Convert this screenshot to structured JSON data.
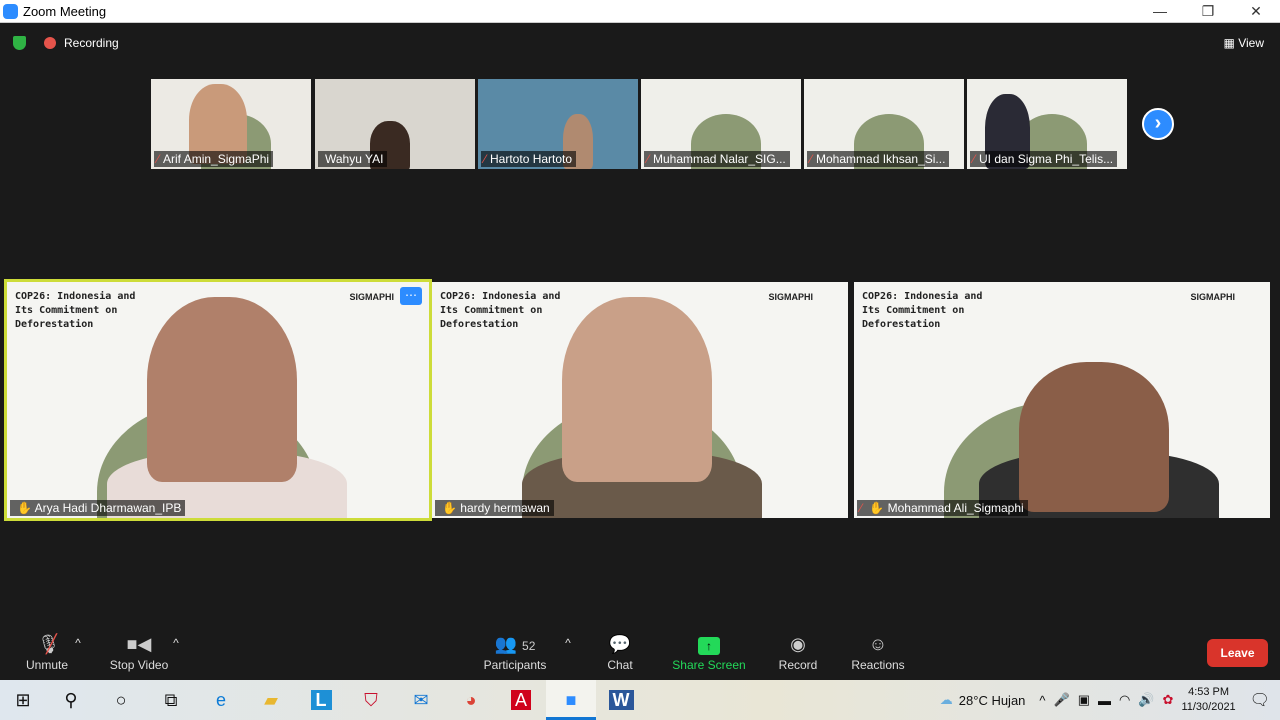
{
  "window": {
    "title": "Zoom Meeting",
    "minimize": "—",
    "maximize": "❐",
    "close": "✕"
  },
  "topbar": {
    "recording": "Recording",
    "view": "View"
  },
  "thumbnails": [
    {
      "name": "Arif Amin_SigmaPhi",
      "muted": true
    },
    {
      "name": "Wahyu YAI",
      "muted": false
    },
    {
      "name": "Hartoto Hartoto",
      "muted": true
    },
    {
      "name": "Muhammad Nalar_SIG...",
      "muted": true
    },
    {
      "name": "Mohammad Ikhsan_Si...",
      "muted": true
    },
    {
      "name": "UI dan Sigma Phi_Telis...",
      "muted": true
    }
  ],
  "slide": {
    "title": "COP26: Indonesia and Its Commitment on Deforestation",
    "brand": "SIGMAPHI"
  },
  "tiles": [
    {
      "name": "Arya Hadi Dharmawan_IPB",
      "active": true,
      "muted": false
    },
    {
      "name": "hardy hermawan",
      "active": false,
      "muted": false
    },
    {
      "name": "Mohammad Ali_Sigmaphi",
      "active": false,
      "muted": true
    }
  ],
  "toolbar": {
    "unmute": "Unmute",
    "stop_video": "Stop Video",
    "participants": "Participants",
    "participants_count": "52",
    "chat": "Chat",
    "share_screen": "Share Screen",
    "record": "Record",
    "reactions": "Reactions",
    "leave": "Leave"
  },
  "colors": {
    "accent": "#2d8cff",
    "share": "#23d959",
    "leave": "#d9342b",
    "active_speaker": "#cddc39"
  },
  "taskbar": {
    "weather": "28°C  Hujan",
    "time": "4:53 PM",
    "date": "11/30/2021"
  }
}
